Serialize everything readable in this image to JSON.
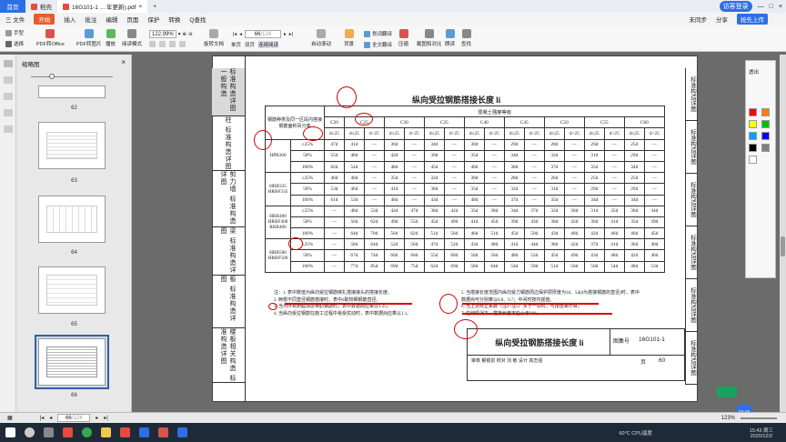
{
  "titlebar": {
    "home_tab": "首页",
    "tabs": [
      {
        "label": "稻壳"
      },
      {
        "label": "16G101-1 ... 年更新).pdf",
        "close": "×"
      }
    ],
    "add_tab": "+",
    "user": "访客登录",
    "window_controls": [
      "—",
      "□",
      "×"
    ]
  },
  "menu": {
    "items": [
      "三 文件",
      "开始",
      "插入",
      "批注",
      "编辑",
      "页面",
      "保护",
      "转换"
    ],
    "search": "Q查找",
    "sync": "未同步",
    "share": "分享",
    "upload": "抢先上传"
  },
  "toolbar": {
    "hand_tool": "手型",
    "select_tool": "选择",
    "pdf_to_office": "PDF转Office",
    "pdf_to_image": "PDF转图片",
    "play": "播放",
    "read_mode": "阅读模式",
    "zoom": "122.99%",
    "rotate": "旋转文档",
    "single_page": "单页",
    "two_page": "双页",
    "continuous": "连续阅读",
    "auto_scroll": "自动滚动",
    "background": "背景",
    "word_translate": "划词翻译",
    "full_translate": "全文翻译",
    "compress": "压缩",
    "screenshot_compare": "截图和对比",
    "read_aloud": "朗读",
    "find": "查找",
    "page_field": "66",
    "page_total": "/124"
  },
  "leftpanel": {
    "title": "缩略图",
    "close": "×",
    "thumbs": [
      {
        "num": "62"
      },
      {
        "num": "63"
      },
      {
        "num": "64"
      },
      {
        "num": "65"
      },
      {
        "num": "66"
      }
    ]
  },
  "doc": {
    "table_title": "纵向受拉钢筋搭接长度 li",
    "left_sections": [
      "标准构造详图 一般构造",
      "柱 标准构造详图",
      "剪力墙 标准构造详图",
      "梁 标准构造详图",
      "板 标准构造详图",
      "楼板相关构造 标准构造详图"
    ],
    "right_sections": [
      "标准构造详图",
      "标准构造详图",
      "标准构造详图",
      "标准构造详图",
      "标准构造详图",
      "标准构造详图"
    ],
    "header_left": "钢筋种类及同一区段内搭接钢筋面积百分率",
    "header_concrete": "混凝土强度等级",
    "grades": [
      "C20",
      "C25",
      "C30",
      "C35",
      "C40",
      "C45",
      "C50",
      "C55",
      "C60"
    ],
    "d_le": "d≤25",
    "d_gt": "d>25",
    "rows": [
      {
        "steel": "HPB300",
        "pct": "≤25%",
        "vals": [
          "47d",
          "41d",
          "—",
          "36d",
          "—",
          "34d",
          "—",
          "30d",
          "—",
          "29d",
          "—",
          "28d",
          "—",
          "26d",
          "—",
          "25d",
          "—"
        ]
      },
      {
        "steel": "",
        "pct": "50%",
        "vals": [
          "55d",
          "48d",
          "—",
          "42d",
          "—",
          "39d",
          "—",
          "35d",
          "—",
          "34d",
          "—",
          "32d",
          "—",
          "31d",
          "—",
          "29d",
          "—"
        ]
      },
      {
        "steel": "",
        "pct": "100%",
        "vals": [
          "62d",
          "54d",
          "—",
          "48d",
          "—",
          "45d",
          "—",
          "40d",
          "—",
          "38d",
          "—",
          "37d",
          "—",
          "35d",
          "—",
          "34d",
          "—"
        ]
      },
      {
        "steel": "HRB335 HRBF335",
        "pct": "≤25%",
        "vals": [
          "46d",
          "40d",
          "—",
          "35d",
          "—",
          "32d",
          "—",
          "30d",
          "—",
          "28d",
          "—",
          "26d",
          "—",
          "25d",
          "—",
          "25d",
          "—"
        ]
      },
      {
        "steel": "",
        "pct": "50%",
        "vals": [
          "53d",
          "46d",
          "—",
          "41d",
          "—",
          "38d",
          "—",
          "35d",
          "—",
          "32d",
          "—",
          "31d",
          "—",
          "29d",
          "—",
          "29d",
          "—"
        ]
      },
      {
        "steel": "",
        "pct": "100%",
        "vals": [
          "61d",
          "53d",
          "—",
          "46d",
          "—",
          "43d",
          "—",
          "40d",
          "—",
          "37d",
          "—",
          "35d",
          "—",
          "34d",
          "—",
          "34d",
          "—"
        ]
      },
      {
        "steel": "HRB400 HRBF400 RRB400",
        "pct": "≤25%",
        "vals": [
          "—",
          "48d",
          "53d",
          "42d",
          "47d",
          "38d",
          "42d",
          "35d",
          "38d",
          "34d",
          "37d",
          "32d",
          "36d",
          "31d",
          "35d",
          "30d",
          "34d"
        ]
      },
      {
        "steel": "",
        "pct": "50%",
        "vals": [
          "—",
          "56d",
          "62d",
          "49d",
          "55d",
          "45d",
          "49d",
          "41d",
          "45d",
          "39d",
          "43d",
          "38d",
          "42d",
          "36d",
          "41d",
          "35d",
          "39d"
        ]
      },
      {
        "steel": "",
        "pct": "100%",
        "vals": [
          "—",
          "64d",
          "70d",
          "56d",
          "62d",
          "51d",
          "56d",
          "46d",
          "51d",
          "45d",
          "50d",
          "43d",
          "48d",
          "42d",
          "46d",
          "40d",
          "45d"
        ]
      },
      {
        "steel": "HRB500 HRBF500",
        "pct": "≤25%",
        "vals": [
          "—",
          "58d",
          "64d",
          "52d",
          "56d",
          "47d",
          "52d",
          "43d",
          "48d",
          "41d",
          "44d",
          "38d",
          "42d",
          "37d",
          "41d",
          "36d",
          "40d"
        ]
      },
      {
        "steel": "",
        "pct": "50%",
        "vals": [
          "—",
          "67d",
          "74d",
          "60d",
          "66d",
          "55d",
          "60d",
          "50d",
          "56d",
          "48d",
          "52d",
          "45d",
          "49d",
          "43d",
          "48d",
          "42d",
          "46d"
        ]
      },
      {
        "steel": "",
        "pct": "100%",
        "vals": [
          "—",
          "77d",
          "85d",
          "69d",
          "75d",
          "62d",
          "69d",
          "58d",
          "64d",
          "54d",
          "59d",
          "51d",
          "56d",
          "50d",
          "54d",
          "48d",
          "53d"
        ]
      }
    ],
    "notes_left": [
      "注：1. 表中数值为纵向受拉钢筋绑扎搭接接头的搭接长度。",
      "2. 两根不同直径钢筋搭接时，表中d取较细钢筋直径。",
      "3. 当为环氧树脂涂层带肋钢筋时，表中数据尚应乘以1.25。",
      "4. 当纵向受拉钢筋在施工过程中易受扰动时，表中数据尚应乘以1.1。"
    ],
    "notes_right": [
      "5. 当搭接长度范围内纵向受力钢筋周边保护层厚度为3d、5d(d为搭接钢筋的直径)时，表中数据尚可分别乘以0.8、0.7；中间时按内插值。",
      "6. 当上述修正系数（注3~注5）多于一项时，可按连乘计算。",
      "7. 任何情况下，搭接长度不应小于300。"
    ],
    "titleblock": {
      "title": "纵向受拉钢筋搭接长度 li",
      "atlas_label": "图集号",
      "atlas": "16G101-1",
      "row2": "审核 郁银泉 校对 刘 敏 设计 高志强",
      "page_label": "页",
      "page": "60"
    }
  },
  "palette": {
    "label": "透出",
    "colors": [
      "#ff0000",
      "#ff8000",
      "#ffff00",
      "#00c000",
      "#00a0ff",
      "#0000ff",
      "#000000",
      "#808080",
      "#ffffff"
    ]
  },
  "statusbar": {
    "page_field": "66",
    "page_total": "/124",
    "zoom": "123%"
  },
  "taskbar": {
    "weather": "60°C CPU温度",
    "time": "15:43 周三",
    "date": "2020/12/2"
  },
  "floating": {
    "timer": "02:46"
  }
}
